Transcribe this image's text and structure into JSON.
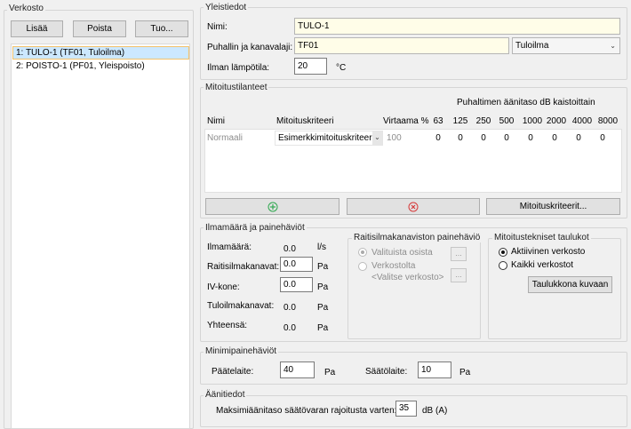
{
  "left": {
    "group_title": "Verkosto",
    "buttons": {
      "add": "Lisää",
      "remove": "Poista",
      "import": "Tuo..."
    },
    "items": [
      "1: TULO-1 (TF01, Tuloilma)",
      "2: POISTO-1 (PF01, Yleispoisto)"
    ]
  },
  "general": {
    "group_title": "Yleistiedot",
    "name_label": "Nimi:",
    "name_value": "TULO-1",
    "fan_label": "Puhallin ja kanavalaji:",
    "fan_value": "TF01",
    "duct_type": "Tuloilma",
    "temp_label": "Ilman lämpötila:",
    "temp_value": "20",
    "temp_unit": "°C"
  },
  "sizing": {
    "group_title": "Mitoitustilanteet",
    "band_header": "Puhaltimen äänitaso dB kaistoittain",
    "columns": {
      "name": "Nimi",
      "criteria": "Mitoituskriteeri",
      "flow": "Virtaama %"
    },
    "bands": [
      "63",
      "125",
      "250",
      "500",
      "1000",
      "2000",
      "4000",
      "8000"
    ],
    "row": {
      "name": "Normaali",
      "criteria": "Esimerkkimitoituskriteeri",
      "flow": "100",
      "levels": [
        "0",
        "0",
        "0",
        "0",
        "0",
        "0",
        "0",
        "0"
      ]
    },
    "criteria_button": "Mitoituskriteerit..."
  },
  "airflow": {
    "group_title": "Ilmamäärä ja painehäviöt",
    "rows": [
      {
        "label": "Ilmamäärä:",
        "value": "0.0",
        "unit": "l/s"
      },
      {
        "label": "Raitisilmakanavat:",
        "value": "0.0",
        "unit": "Pa"
      },
      {
        "label": "IV-kone:",
        "value": "0.0",
        "unit": "Pa"
      },
      {
        "label": "Tuloilmakanavat:",
        "value": "0.0",
        "unit": "Pa"
      },
      {
        "label": "Yhteensä:",
        "value": "0.0",
        "unit": "Pa"
      }
    ]
  },
  "fresh_air": {
    "group_title": "Raitisilmakanaviston painehäviö",
    "option1": "Valituista osista",
    "option2": "Verkostolta",
    "network_placeholder": "<Valitse verkosto>",
    "dots": "..."
  },
  "tables": {
    "group_title": "Mitoitustekniset taulukot",
    "option1": "Aktiivinen verkosto",
    "option2": "Kaikki verkostot",
    "show_button": "Taulukkona kuvaan"
  },
  "min_pressure": {
    "group_title": "Minimipainehäviöt",
    "terminal_label": "Päätelaite:",
    "terminal_value": "40",
    "terminal_unit": "Pa",
    "damper_label": "Säätölaite:",
    "damper_value": "10",
    "damper_unit": "Pa"
  },
  "sound": {
    "group_title": "Äänitiedot",
    "max_label": "Maksimiäänitaso säätövaran rajoitusta varten:",
    "max_value": "35",
    "max_unit": "dB (A)"
  },
  "colors": {
    "selection_bg": "#cce8ff",
    "selection_border": "#f3c26b",
    "add_icon": "#2fa84f",
    "remove_icon": "#d63a3a"
  }
}
